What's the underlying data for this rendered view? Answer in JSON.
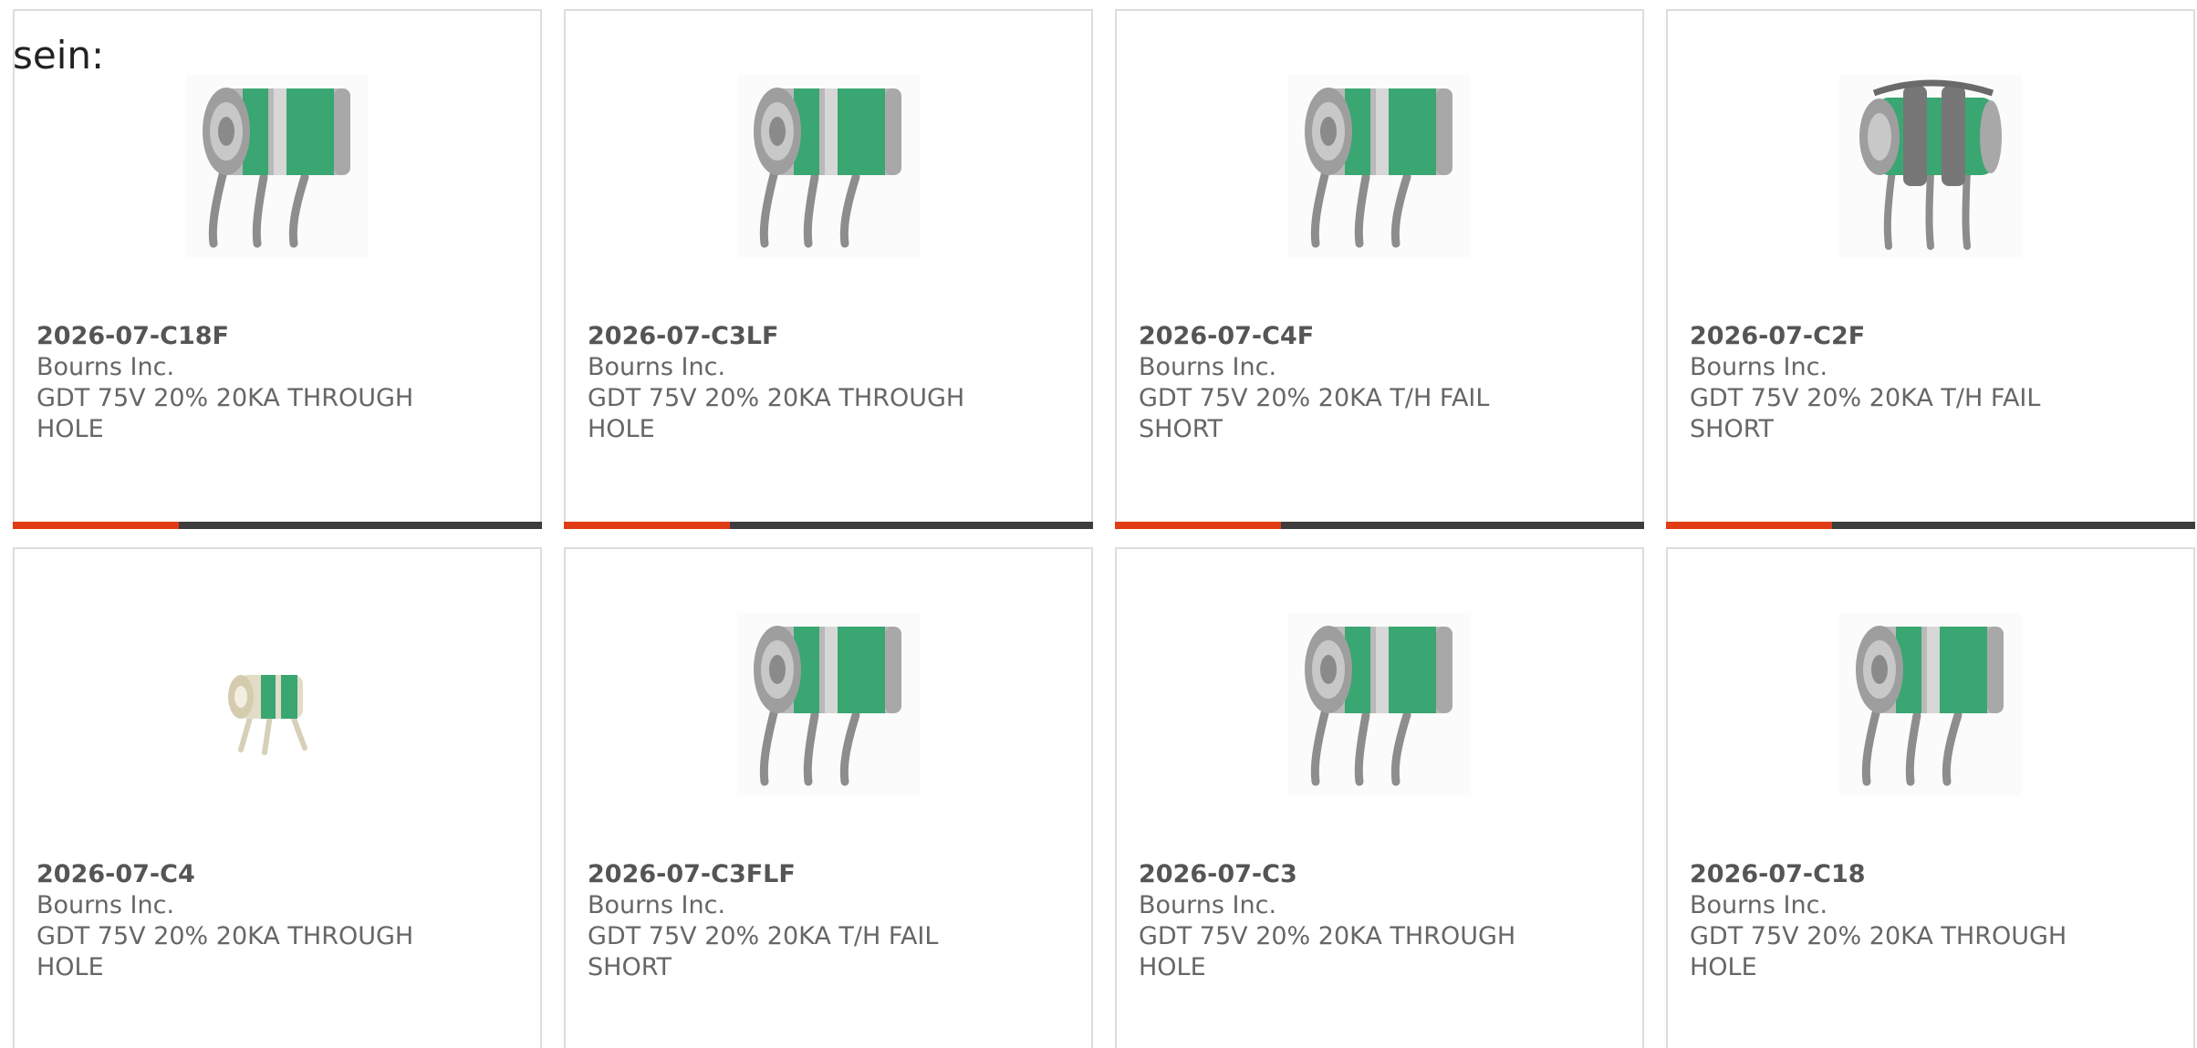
{
  "page": {
    "lead_text": "sein:"
  },
  "colors": {
    "accent_red": "#e03c16",
    "accent_dark": "#3c3c3c",
    "band_green": "#3aa672",
    "body_gray": "#9a9a9a"
  },
  "products": [
    {
      "part": "2026-07-C18F",
      "mfr": "Bourns Inc.",
      "desc": "GDT 75V 20% 20KA THROUGH HOLE",
      "image": "gdt-3-lead-icon"
    },
    {
      "part": "2026-07-C3LF",
      "mfr": "Bourns Inc.",
      "desc": "GDT 75V 20% 20KA THROUGH HOLE",
      "image": "gdt-3-lead-icon"
    },
    {
      "part": "2026-07-C4F",
      "mfr": "Bourns Inc.",
      "desc": "GDT 75V 20% 20KA T/H FAIL SHORT",
      "image": "gdt-3-lead-icon"
    },
    {
      "part": "2026-07-C2F",
      "mfr": "Bourns Inc.",
      "desc": "GDT 75V 20% 20KA T/H FAIL SHORT",
      "image": "gdt-fail-short-clip-icon"
    },
    {
      "part": "2026-07-C4",
      "mfr": "Bourns Inc.",
      "desc": "GDT 75V 20% 20KA THROUGH HOLE",
      "image": "gdt-small-icon"
    },
    {
      "part": "2026-07-C3FLF",
      "mfr": "Bourns Inc.",
      "desc": "GDT 75V 20% 20KA T/H FAIL SHORT",
      "image": "gdt-3-lead-icon"
    },
    {
      "part": "2026-07-C3",
      "mfr": "Bourns Inc.",
      "desc": "GDT 75V 20% 20KA THROUGH HOLE",
      "image": "gdt-3-lead-icon"
    },
    {
      "part": "2026-07-C18",
      "mfr": "Bourns Inc.",
      "desc": "GDT 75V 20% 20KA THROUGH HOLE",
      "image": "gdt-3-lead-icon"
    }
  ]
}
